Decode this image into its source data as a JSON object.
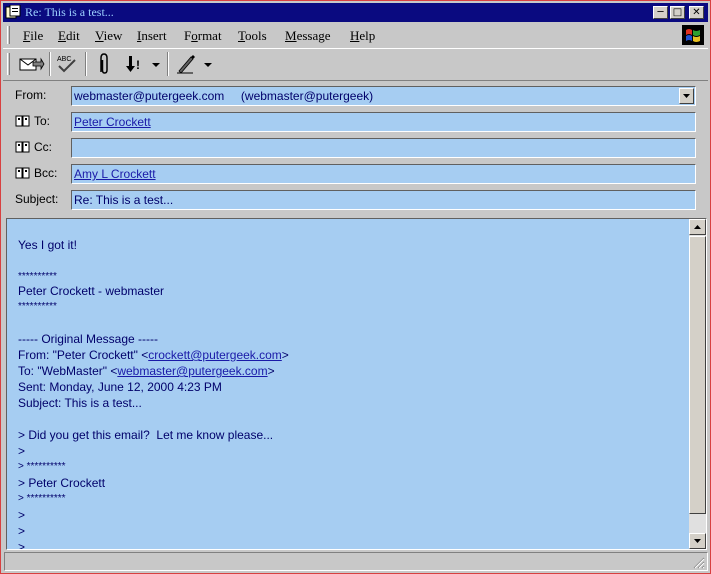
{
  "window": {
    "title": "Re: This is a test...",
    "minimize_icon": "minimize-icon",
    "maximize_icon": "maximize-icon",
    "close_icon": "close-icon"
  },
  "menu": [
    "File",
    "Edit",
    "View",
    "Insert",
    "Format",
    "Tools",
    "Message",
    "Help"
  ],
  "menu_underline": [
    "F",
    "E",
    "V",
    "I",
    "o",
    "T",
    "M",
    "H"
  ],
  "toolbar": {
    "icons": [
      "send-icon",
      "spelling-check-icon",
      "attach-icon",
      "priority-icon",
      "signature-icon"
    ],
    "spell_text": "ABC"
  },
  "header": {
    "from_label": "From:",
    "from_value": "webmaster@putergeek.com     (webmaster@putergeek)",
    "to_label": "To:",
    "to_value": "Peter Crockett",
    "cc_label": "Cc:",
    "cc_value": "",
    "bcc_label": "Bcc:",
    "bcc_value": "Amy L Crockett",
    "subject_label": "Subject:",
    "subject_value": "Re: This is a test..."
  },
  "message": {
    "line1": "Yes I got it!",
    "stars1": "**********",
    "sig_name": "Peter Crockett - webmaster",
    "stars2": "**********",
    "orig_header": "----- Original Message -----",
    "from_prefix": "From: \"Peter Crockett\" <",
    "from_link": "crockett@putergeek.com",
    "from_suffix": ">",
    "to_prefix": "To: \"WebMaster\" <",
    "to_link": "webmaster@putergeek.com",
    "to_suffix": ">",
    "sent": "Sent: Monday, June 12, 2000 4:23 PM",
    "subject": "Subject: This is a test...",
    "q1": "> Did you get this email?  Let me know please...",
    "q2": ">",
    "q3": "> **********",
    "q4": "> Peter Crockett",
    "q5": "> **********",
    "q6": ">",
    "q7": ">",
    "q8": ">"
  }
}
